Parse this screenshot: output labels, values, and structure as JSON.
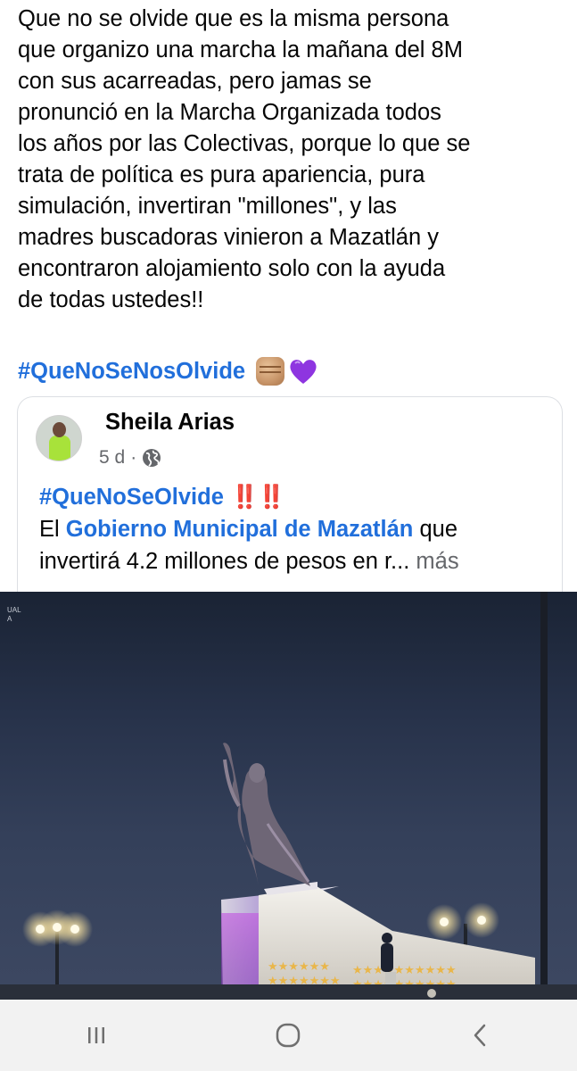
{
  "post": {
    "body_lines": [
      "Que no se olvide que es la misma persona",
      "que organizo una marcha la mañana del 8M",
      "con sus acarreadas, pero jamas se",
      "pronunció en la Marcha Organizada todos",
      "los años por las Colectivas, porque lo que se",
      "trata de política es pura apariencia, pura",
      "simulación, invertiran \"millones\", y las",
      "madres buscadoras vinieron a Mazatlán y",
      "encontraron alojamiento solo con la ayuda",
      "de todas ustedes!!"
    ],
    "hashtag": "#QueNoSeNosOlvide",
    "emojis": [
      "raised-fist-medium-skin",
      "purple-heart"
    ]
  },
  "shared_post": {
    "author": "Sheila Arias",
    "time": "5 d",
    "separator": "·",
    "hashtag": "#QueNoSeOlvide",
    "bangs": "‼️‼️",
    "text_prefix": "El ",
    "link_text": "Gobierno Municipal de Mazatlán",
    "text_after_link": " que",
    "line3": "invertirá 4.2 millones de pesos en r...",
    "more_label": "más"
  },
  "image": {
    "corner_text_1": "UAL",
    "corner_text_2": "A"
  },
  "nav_bar": {
    "buttons": [
      "recent-apps",
      "home",
      "back"
    ]
  }
}
